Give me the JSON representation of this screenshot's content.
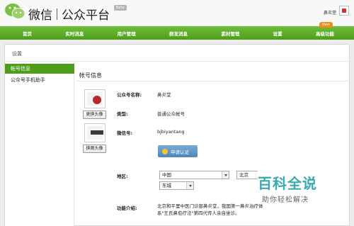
{
  "header": {
    "brand_wechat": "微信",
    "brand_platform": "公众平台",
    "beta": "Beta",
    "user_name": "鼻炎堂"
  },
  "nav": {
    "items": [
      {
        "label": "首页"
      },
      {
        "label": "实时消息"
      },
      {
        "label": "用户管理"
      },
      {
        "label": "群发消息"
      },
      {
        "label": "素材管理"
      },
      {
        "label": "设置"
      },
      {
        "label": "高级功能"
      }
    ],
    "new_badge": "New"
  },
  "page": {
    "title": "设置"
  },
  "sidebar": {
    "items": [
      {
        "label": "帐号信息",
        "active": true
      },
      {
        "label": "公众号手机助手",
        "active": false
      }
    ]
  },
  "account": {
    "section_title": "帐号信息",
    "change_avatar_label": "更换头像",
    "change_qr_label": "换图头像",
    "name_label": "公众号名称:",
    "name_value": "鼻炎堂",
    "type_label": "类型:",
    "type_value": "普通公众帐号",
    "wechat_id_label": "微信号:",
    "wechat_id_value": "bjbiyantang",
    "verify_button": "申请认证",
    "region_label": "地区:",
    "region_country": "中国",
    "region_city": "北京",
    "region_district": "东城",
    "intro_label": "功能介绍:",
    "intro_text": "北京和平里中医门诊部鼻炎堂，我国第一鼻炎治疗体系\"王氏鼻愈疗法\"第四代传人亲自坐诊。"
  },
  "watermark": {
    "title": "百科全说",
    "subtitle": "助你轻松解决"
  },
  "colors": {
    "nav_green": "#5aa82a",
    "active_green": "#4e9e1c",
    "verify_blue": "#5b8fc4",
    "new_orange": "#f08a1e",
    "watermark_teal": "#3aa9b2"
  }
}
